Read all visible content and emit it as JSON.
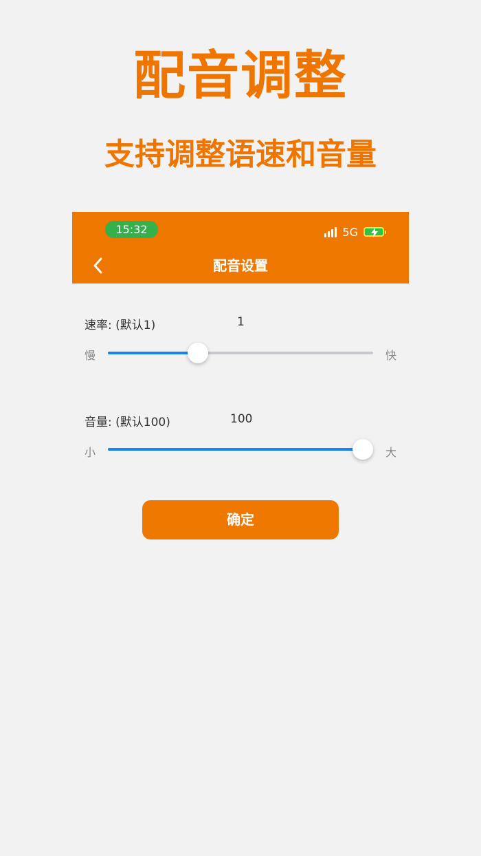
{
  "promo": {
    "title": "配音调整",
    "subtitle": "支持调整语速和音量"
  },
  "status_bar": {
    "time": "15:32",
    "network": "5G",
    "battery_icon": "charging-battery-icon"
  },
  "nav": {
    "title": "配音设置",
    "back_icon": "chevron-left-icon"
  },
  "settings": {
    "speed": {
      "label": "速率: (默认1)",
      "value": "1",
      "min_label": "慢",
      "max_label": "快",
      "level": 0.34
    },
    "volume": {
      "label": "音量: (默认100)",
      "value": "100",
      "min_label": "小",
      "max_label": "大",
      "level": 1.0
    }
  },
  "confirm_label": "确定",
  "colors": {
    "accent": "#ee7700",
    "slider_fill": "#1a82f0",
    "time_pill": "#34b14b"
  }
}
